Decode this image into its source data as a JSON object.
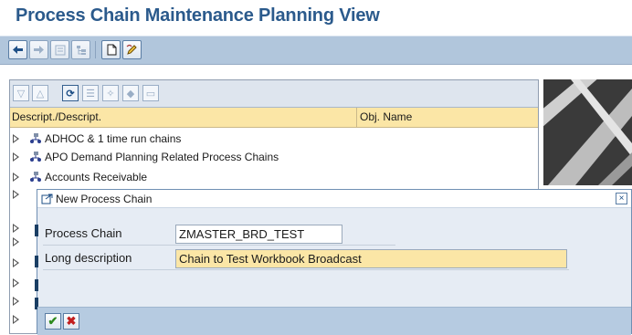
{
  "page": {
    "title": "Process Chain Maintenance Planning View"
  },
  "tree": {
    "columns": [
      "Descript./Descript.",
      "Obj. Name"
    ],
    "rows": [
      {
        "label": "ADHOC & 1 time run chains"
      },
      {
        "label": "APO Demand Planning Related Process Chains"
      },
      {
        "label": "Accounts Receivable"
      }
    ]
  },
  "dialog": {
    "title": "New Process Chain",
    "fields": {
      "process_chain": {
        "label": "Process Chain",
        "value": "ZMASTER_BRD_TEST"
      },
      "long_description": {
        "label": "Long description",
        "value": "Chain to Test Workbook Broadcast"
      }
    }
  },
  "icons": {
    "main_toolbar": [
      "back-arrow-icon",
      "forward-arrow-icon",
      "display-icon",
      "hierarchy-icon",
      "new-document-icon",
      "edit-icon"
    ],
    "tree_toolbar": [
      "expand-all-icon",
      "collapse-all-icon",
      "refresh-icon",
      "node-structure-icon",
      "settings-icon",
      "tag-icon",
      "document-icon"
    ],
    "dialog_footer": [
      "confirm-check-icon",
      "cancel-x-icon"
    ]
  },
  "colors": {
    "title": "#2b5a8c",
    "toolbar": "#b1c6dc",
    "column_header": "#fbe6a6",
    "required_field": "#fbe6a6",
    "confirm": "#2e8a1e",
    "cancel": "#c21e1e"
  }
}
